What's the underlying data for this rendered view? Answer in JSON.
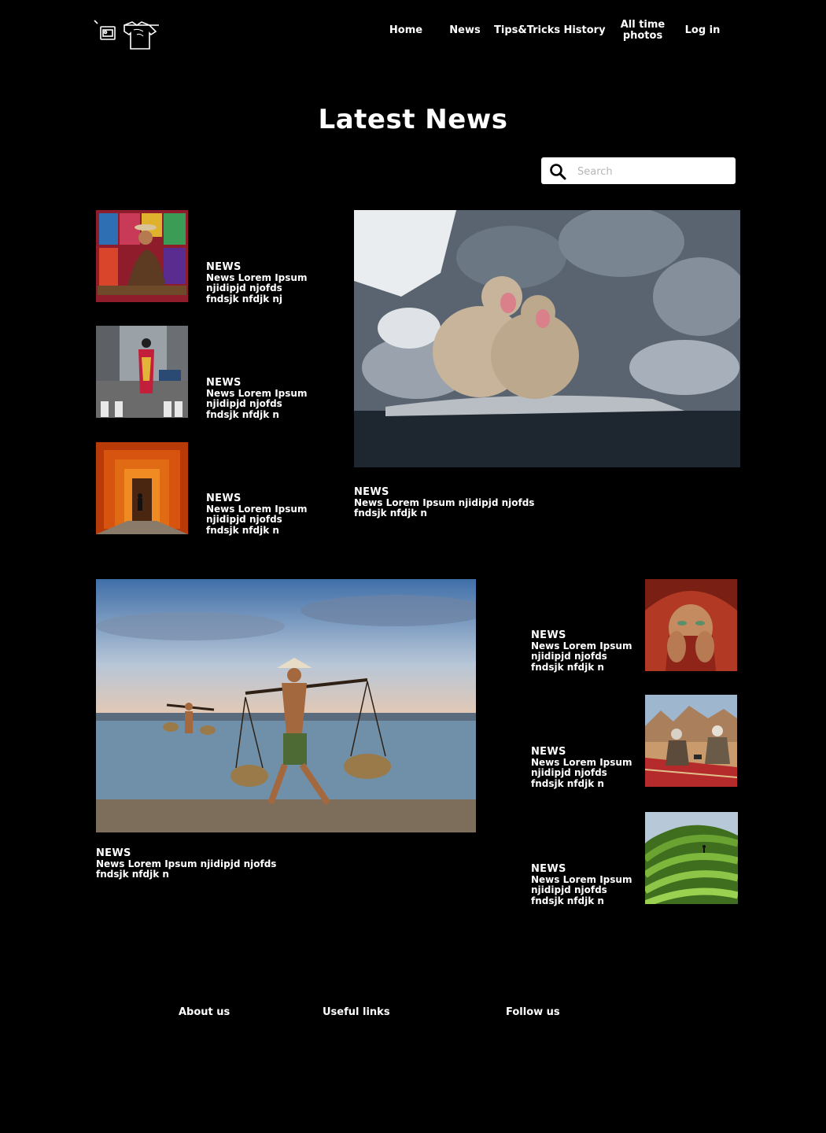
{
  "nav": {
    "items": [
      "Home",
      "News",
      "Tips&Tricks",
      "History",
      "All time photos",
      "Log in"
    ]
  },
  "page_title": "Latest News",
  "search": {
    "placeholder": "Search"
  },
  "articles": {
    "top_left": [
      {
        "label": "NEWS",
        "text": "News Lorem Ipsum njidipjd njofds fndsjk nfdjk nj"
      },
      {
        "label": "NEWS",
        "text": "News Lorem Ipsum njidipjd njofds fndsjk nfdjk n"
      },
      {
        "label": "NEWS",
        "text": "News Lorem Ipsum njidipjd njofds fndsjk nfdjk n"
      }
    ],
    "featured_right": {
      "label": "NEWS",
      "text": "News Lorem Ipsum njidipjd njofds fndsjk nfdjk n"
    },
    "featured_left": {
      "label": "NEWS",
      "text": "News Lorem Ipsum njidipjd njofds fndsjk nfdjk n"
    },
    "bottom_right": [
      {
        "label": "NEWS",
        "text": "News Lorem Ipsum njidipjd njofds fndsjk nfdjk n"
      },
      {
        "label": "NEWS",
        "text": "News Lorem Ipsum njidipjd njofds fndsjk nfdjk n"
      },
      {
        "label": "NEWS",
        "text": "News Lorem Ipsum njidipjd njofds fndsjk nfdjk n"
      }
    ]
  },
  "footer": {
    "links": [
      "About us",
      "Useful links",
      "Follow us"
    ]
  },
  "colors": {
    "background": "#000000",
    "text": "#ffffff",
    "search_bg": "#ffffff"
  }
}
